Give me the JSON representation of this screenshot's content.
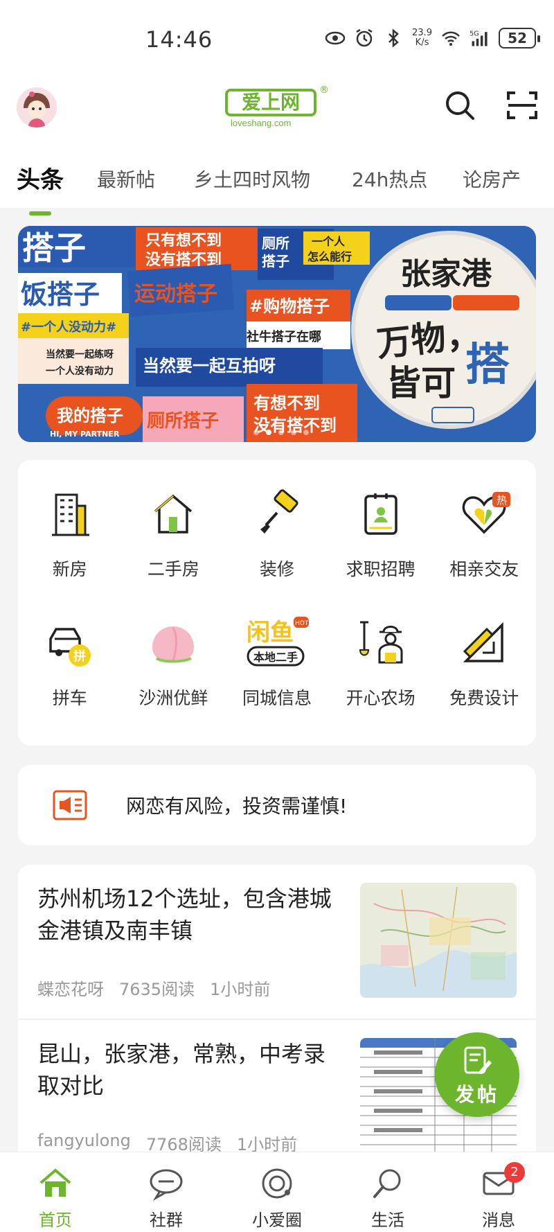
{
  "status": {
    "time": "14:46",
    "speed_value": "23.9",
    "speed_unit": "K/s",
    "network": "5G",
    "battery": "52"
  },
  "header": {
    "logo_text": "爱上网",
    "logo_sub": "loveshang.com",
    "logo_reg": "®",
    "tabs": [
      {
        "label": "头条",
        "active": true
      },
      {
        "label": "最新帖"
      },
      {
        "label": "乡土四时风物"
      },
      {
        "label": "24h热点"
      },
      {
        "label": "论房产"
      }
    ]
  },
  "banner": {
    "texts": [
      "搭子",
      "只有想不到",
      "没有搭不到",
      "厕所",
      "搭子",
      "一个人",
      "怎么能行",
      "饭搭子",
      "运动搭子",
      "#购物搭子",
      "张家港",
      "万物，",
      "皆可",
      "搭",
      "社牛搭子在哪",
      "#一个人没动力#",
      "当然要一起练呀",
      "一个人没有动力",
      "当然要一起互拍呀",
      "我的搭子",
      "HI, MY PARTNER",
      "厕所搭子",
      "有想不到",
      "没有搭不到"
    ],
    "active_dot": 1,
    "dot_count": 5
  },
  "grid": [
    {
      "label": "新房",
      "icon": "building-icon"
    },
    {
      "label": "二手房",
      "icon": "house-icon"
    },
    {
      "label": "装修",
      "icon": "paint-roller-icon"
    },
    {
      "label": "求职招聘",
      "icon": "id-badge-icon"
    },
    {
      "label": "相亲交友",
      "icon": "heart-icon",
      "badge": "热"
    },
    {
      "label": "拼车",
      "icon": "car-icon",
      "badge": "拼"
    },
    {
      "label": "沙洲优鲜",
      "icon": "peach-icon"
    },
    {
      "label": "同城信息",
      "icon": "xianyu-icon",
      "sub": "本地二手",
      "badge": "HOT",
      "brand": "闲鱼"
    },
    {
      "label": "开心农场",
      "icon": "farmer-icon"
    },
    {
      "label": "免费设计",
      "icon": "ruler-icon"
    }
  ],
  "notice": {
    "text": "网恋有风险，投资需谨慎!"
  },
  "feed": [
    {
      "title": "苏州机场12个选址，包含港城金港镇及南丰镇",
      "author": "蝶恋花呀",
      "reads": "7635阅读",
      "time": "1小时前"
    },
    {
      "title": "昆山，张家港，常熟，中考录取对比",
      "author": "fangyulong",
      "reads": "7768阅读",
      "time": "1小时前"
    }
  ],
  "fab": {
    "label": "发帖"
  },
  "nav": [
    {
      "label": "首页",
      "active": true
    },
    {
      "label": "社群"
    },
    {
      "label": "小爱圈"
    },
    {
      "label": "生活"
    },
    {
      "label": "消息",
      "badge": "2"
    }
  ],
  "colors": {
    "brand": "#6cb52d",
    "badge": "#f03a3a",
    "banner_bg": "#2f64b4"
  }
}
